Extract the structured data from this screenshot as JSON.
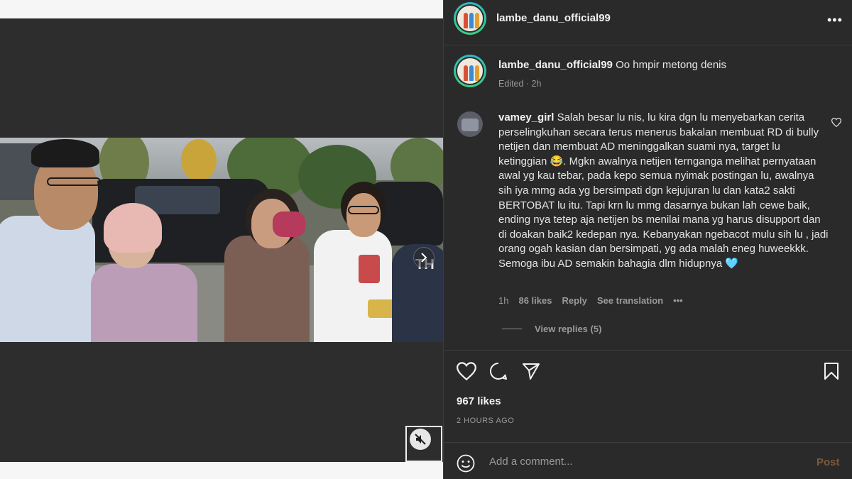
{
  "post": {
    "username": "lambe_danu_official99",
    "more_icon": "more-horizontal-icon",
    "caption_user": "lambe_danu_official99",
    "caption_text": "Oo hmpir metong denis",
    "caption_meta": "Edited · 2h"
  },
  "comment": {
    "user": "vamey_girl",
    "text": "Salah besar lu nis, lu kira dgn lu menyebarkan cerita perselingkuhan secara terus menerus bakalan membuat RD di bully netijen dan membuat AD meninggalkan suami nya, target lu ketinggian 😂. Mgkn awalnya netijen terngangа melihat pernyataan awal yg kau tebar, pada kepo semua nyimak postingan lu, awalnya sih iya mmg ada yg bersimpati dgn kejujuran lu dan kata2 sakti BERTOBAT lu itu. Tapi krn lu mmg dasarnya bukan lah cewe baik, ending nya tetep aja netijen bs menilai mana yg harus disupport dan di doakan baik2 kedepan nya. Kebanyakan ngebacot mulu sih lu , jadi orang ogah kasian dan bersimpati, yg ada malah eneg huweekkk. Semoga ibu AD semakin bahagia dlm hidupnya 🩵",
    "time": "1h",
    "likes": "86 likes",
    "reply": "Reply",
    "see_translation": "See translation",
    "more": "•••",
    "view_replies": "View replies (5)"
  },
  "footer": {
    "likes": "967 likes",
    "timestamp": "2 HOURS AGO",
    "comment_placeholder": "Add a comment...",
    "post_label": "Post"
  },
  "colors": {
    "panel_bg": "#2a2a2a",
    "ring": "#2fb6c8",
    "post_disabled": "#7a5a3a"
  }
}
